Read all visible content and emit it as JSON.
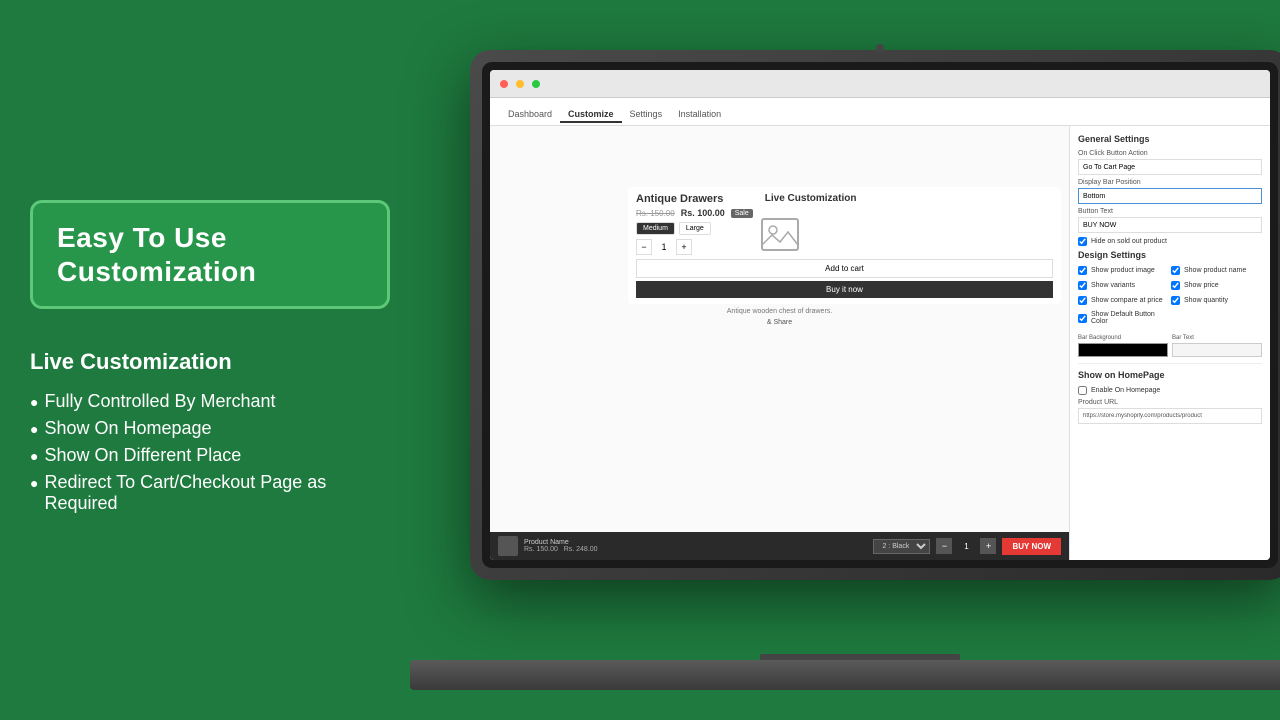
{
  "background_color": "#1e7a3e",
  "left_panel": {
    "badge": {
      "text": "Easy To Use Customization"
    },
    "section_title": "Live Customization",
    "bullets": [
      "Fully Controlled By Merchant",
      "Show On Homepage",
      "Show On Different Place",
      "Redirect To Cart/Checkout Page as Required"
    ]
  },
  "screen": {
    "nav_tabs": [
      "Dashboard",
      "Customize",
      "Settings",
      "Installation"
    ],
    "active_tab": "Customize",
    "live_label": "Live Customization",
    "product": {
      "name": "Antique Drawers",
      "original_price": "Rs. 150.00",
      "sale_price": "Rs. 100.00",
      "sale_badge": "Sale",
      "sizes": [
        "Medium",
        "Large"
      ],
      "active_size": "Medium",
      "quantity": "1",
      "add_to_cart_label": "Add to cart",
      "buy_now_label": "Buy it now",
      "description": "Antique wooden chest of drawers.",
      "share_label": "& Share"
    },
    "sticky_bar": {
      "product_name": "Product Name",
      "original_price": "Rs. 150.00",
      "sale_price": "Rs. 248.00",
      "bar_selector": "2 : Black",
      "quantity": "1",
      "buy_button": "BUY NOW"
    },
    "settings": {
      "general_title": "General Settings",
      "on_click_label": "On Click Button Action",
      "on_click_value": "Go To Cart Page",
      "display_bar_label": "Display Bar Position",
      "display_bar_value": "Bottom",
      "button_text_label": "Button Text",
      "button_text_value": "BUY NOW",
      "hide_sold_out_label": "Hide on sold out product",
      "design_title": "Design Settings",
      "design_checkboxes": [
        "Show product image",
        "Show product name",
        "Show variants",
        "Show price",
        "Show compare at price",
        "Show quantity",
        "Show Default Button Color"
      ],
      "bar_background_label": "Bar Background",
      "bar_text_label": "Bar Text",
      "homepage_title": "Show on HomePage",
      "enable_homepage_label": "Enable On Homepage",
      "product_url_label": "Product URL",
      "product_url_value": "https://store.myshopify.com/products/product"
    }
  }
}
